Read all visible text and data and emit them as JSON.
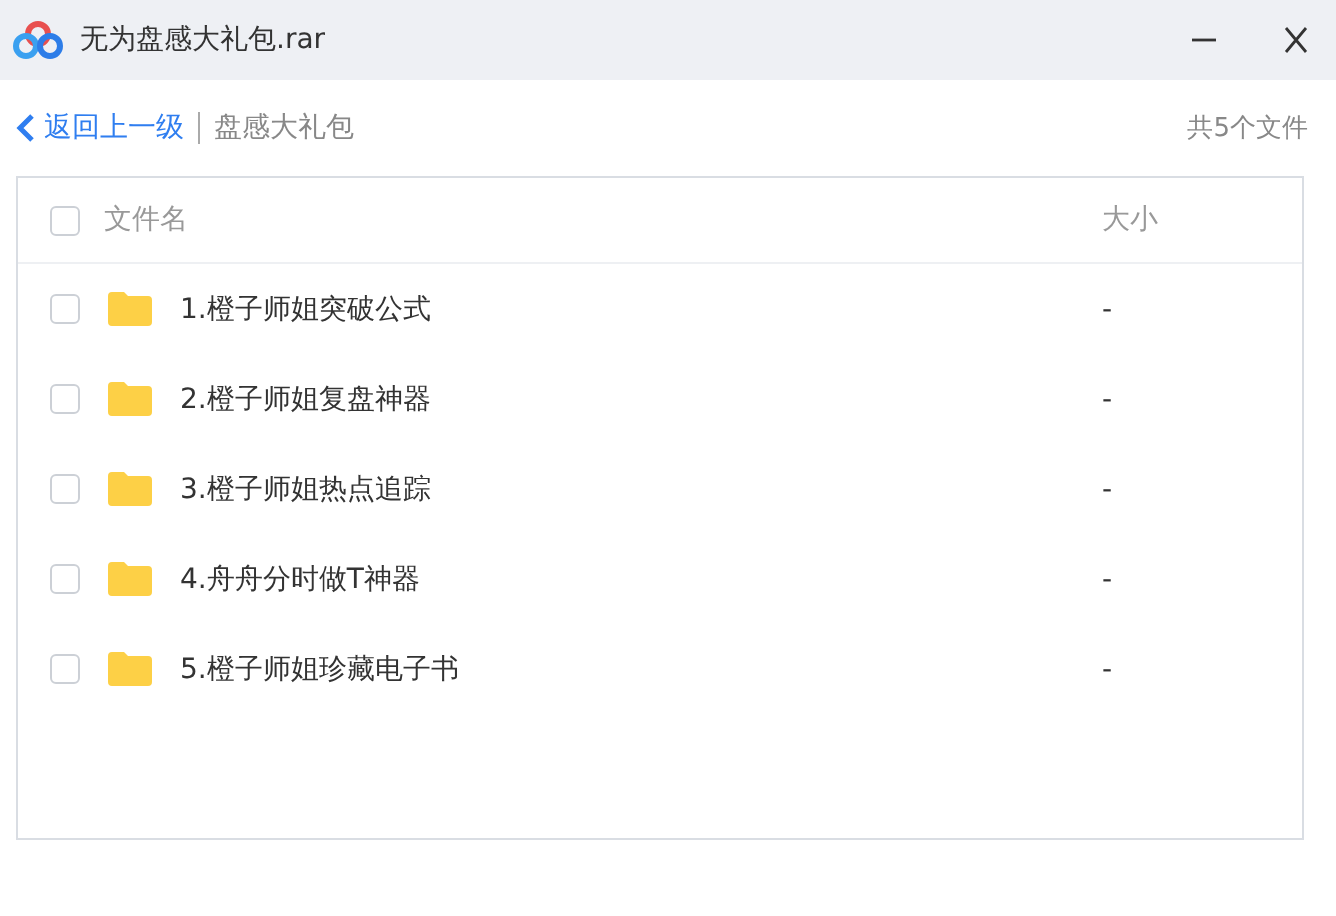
{
  "window": {
    "title": "无为盘感大礼包.rar"
  },
  "nav": {
    "back": "返回上一级",
    "path": "盘感大礼包",
    "count": "共5个文件"
  },
  "table": {
    "columns": [
      "文件名",
      "大小"
    ],
    "all_checked": false,
    "rows": [
      {
        "name": "1.橙子师姐突破公式",
        "size": "-",
        "checked": false
      },
      {
        "name": "2.橙子师姐复盘神器",
        "size": "-",
        "checked": false
      },
      {
        "name": "3.橙子师姐热点追踪",
        "size": "-",
        "checked": false
      },
      {
        "name": "4.舟舟分时做T神器",
        "size": "-",
        "checked": false
      },
      {
        "name": "5.橙子师姐珍藏电子书",
        "size": "-",
        "checked": false
      }
    ]
  }
}
